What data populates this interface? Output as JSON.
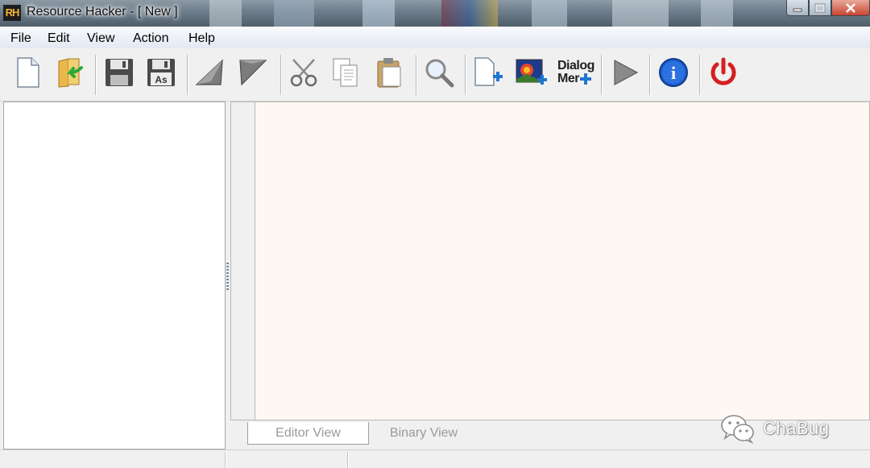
{
  "window": {
    "app_logo": "RH",
    "title": "Resource Hacker - [ New ]",
    "controls": [
      "minimize-icon",
      "restore-icon",
      "close-icon"
    ]
  },
  "menu": {
    "items": [
      "File",
      "Edit",
      "View",
      "Action",
      "Help"
    ]
  },
  "toolbar": {
    "buttons": [
      {
        "icon": "new-file-icon"
      },
      {
        "icon": "open-file-icon"
      },
      {
        "icon": "save-icon"
      },
      {
        "icon": "save-as-icon",
        "label": "As"
      },
      {
        "icon": "compile-icon"
      },
      {
        "icon": "compare-icon"
      },
      {
        "icon": "cut-icon"
      },
      {
        "icon": "copy-icon"
      },
      {
        "icon": "paste-icon"
      },
      {
        "icon": "find-icon"
      },
      {
        "icon": "add-resource-icon"
      },
      {
        "icon": "add-image-icon"
      },
      {
        "icon": "dialog-menu-icon",
        "line1": "Dialog",
        "line2": "Mer"
      },
      {
        "icon": "run-icon"
      },
      {
        "icon": "info-icon",
        "label": "i"
      },
      {
        "icon": "power-icon"
      }
    ],
    "accent_colors": {
      "blue": "#1f76d2",
      "green": "#2fa83a",
      "red": "#d42020"
    }
  },
  "editor": {
    "tabs": [
      "Editor View",
      "Binary View"
    ],
    "active_tab": "Editor View",
    "background": "#fff8f2"
  },
  "watermark": {
    "text": "ChaBug",
    "icon": "wechat-icon"
  }
}
